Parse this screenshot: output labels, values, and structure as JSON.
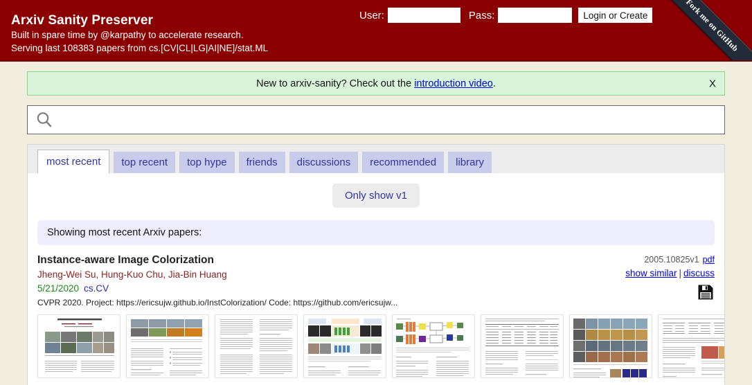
{
  "header": {
    "site_title": "Arxiv Sanity Preserver",
    "tagline_1": "Built in spare time by @karpathy to accelerate research.",
    "tagline_2": "Serving last 108383 papers from cs.[CV|CL|LG|AI|NE]/stat.ML",
    "user_label": "User:",
    "pass_label": "Pass:",
    "user_value": "",
    "pass_value": "",
    "login_button": "Login or Create",
    "github_ribbon": "Fork me on GitHub",
    "bg_color": "#8b0000"
  },
  "intro_banner": {
    "text_before": "New to arxiv-sanity? Check out the ",
    "link_text": "introduction video",
    "text_after": ".",
    "close_label": "X",
    "bg_color": "#d9f5d9"
  },
  "search": {
    "value": "",
    "placeholder": "",
    "icon": "search-icon"
  },
  "tabs": [
    {
      "label": "most recent",
      "active": true
    },
    {
      "label": "top recent",
      "active": false
    },
    {
      "label": "top hype",
      "active": false
    },
    {
      "label": "friends",
      "active": false
    },
    {
      "label": "discussions",
      "active": false
    },
    {
      "label": "recommended",
      "active": false
    },
    {
      "label": "library",
      "active": false
    }
  ],
  "filter": {
    "only_v1_label": "Only show v1"
  },
  "status": {
    "message": "Showing most recent Arxiv papers:"
  },
  "paper": {
    "title": "Instance-aware Image Colorization",
    "authors": "Jheng-Wei Su, Hung-Kuo Chu, Jia-Bin Huang",
    "date": "5/21/2020",
    "category": "cs.CV",
    "comment": "CVPR 2020. Project: https://ericsujw.github.io/InstColorization/ Code: https://github.com/ericsujw...",
    "arxiv_id": "2005.10825v1",
    "pdf_label": "pdf",
    "show_similar_label": "show similar",
    "separator": "|",
    "discuss_label": "discuss",
    "save_icon": "floppy-disk-save-icon",
    "thumbnail_count": 9
  },
  "colors": {
    "header_red": "#8b0000",
    "page_bg": "#f2eedd",
    "tab_inactive": "#c9cbeb",
    "tab_text": "#33339e",
    "link_blue": "#0000ee",
    "author_red": "#8b2222",
    "date_green": "#1a8a1a",
    "category_blue": "#2a2aa8",
    "banner_green": "#d9f5d9",
    "status_lavender": "#eeeefc"
  }
}
